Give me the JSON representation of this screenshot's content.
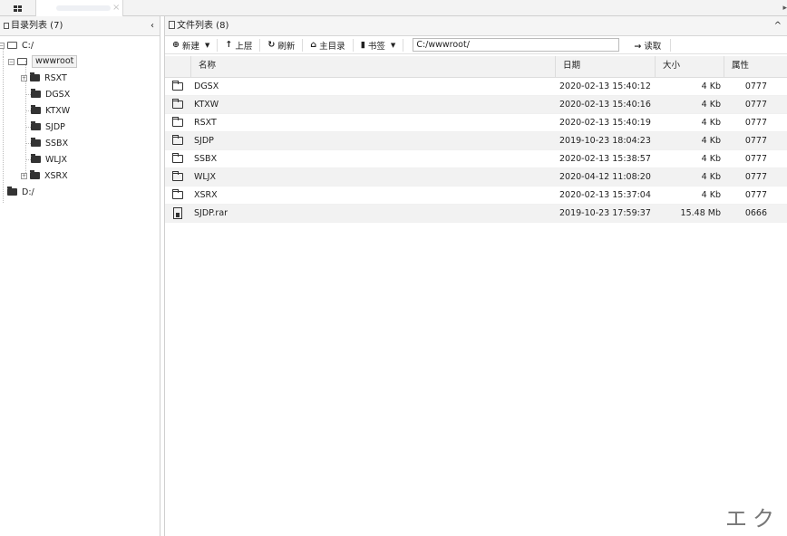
{
  "tabs": {
    "close": "×",
    "scroll": "▸"
  },
  "left": {
    "title": "目录列表 (7)",
    "collapse": "‹"
  },
  "tree": {
    "root_c": "C:/",
    "wwwroot": "wwwroot",
    "children": [
      "RSXT",
      "DGSX",
      "KTXW",
      "SJDP",
      "SSBX",
      "WLJX",
      "XSRX"
    ],
    "root_d": "D:/"
  },
  "right": {
    "title": "文件列表 (8)",
    "collapse": "^"
  },
  "toolbar": {
    "new": "新建",
    "up": "上层",
    "refresh": "刷新",
    "home": "主目录",
    "bookmark": "书签",
    "path": "C:/wwwroot/",
    "read": "读取"
  },
  "columns": {
    "name": "名称",
    "date": "日期",
    "size": "大小",
    "attr": "属性"
  },
  "files": [
    {
      "name": "DGSX",
      "date": "2020-02-13 15:40:12",
      "size": "4 Kb",
      "attr": "0777",
      "type": "folder"
    },
    {
      "name": "KTXW",
      "date": "2020-02-13 15:40:16",
      "size": "4 Kb",
      "attr": "0777",
      "type": "folder"
    },
    {
      "name": "RSXT",
      "date": "2020-02-13 15:40:19",
      "size": "4 Kb",
      "attr": "0777",
      "type": "folder"
    },
    {
      "name": "SJDP",
      "date": "2019-10-23 18:04:23",
      "size": "4 Kb",
      "attr": "0777",
      "type": "folder"
    },
    {
      "name": "SSBX",
      "date": "2020-02-13 15:38:57",
      "size": "4 Kb",
      "attr": "0777",
      "type": "folder"
    },
    {
      "name": "WLJX",
      "date": "2020-04-12 11:08:20",
      "size": "4 Kb",
      "attr": "0777",
      "type": "folder"
    },
    {
      "name": "XSRX",
      "date": "2020-02-13 15:37:04",
      "size": "4 Kb",
      "attr": "0777",
      "type": "folder"
    },
    {
      "name": "SJDP.rar",
      "date": "2019-10-23 17:59:37",
      "size": "15.48 Mb",
      "attr": "0666",
      "type": "archive"
    }
  ],
  "watermark": "エク"
}
